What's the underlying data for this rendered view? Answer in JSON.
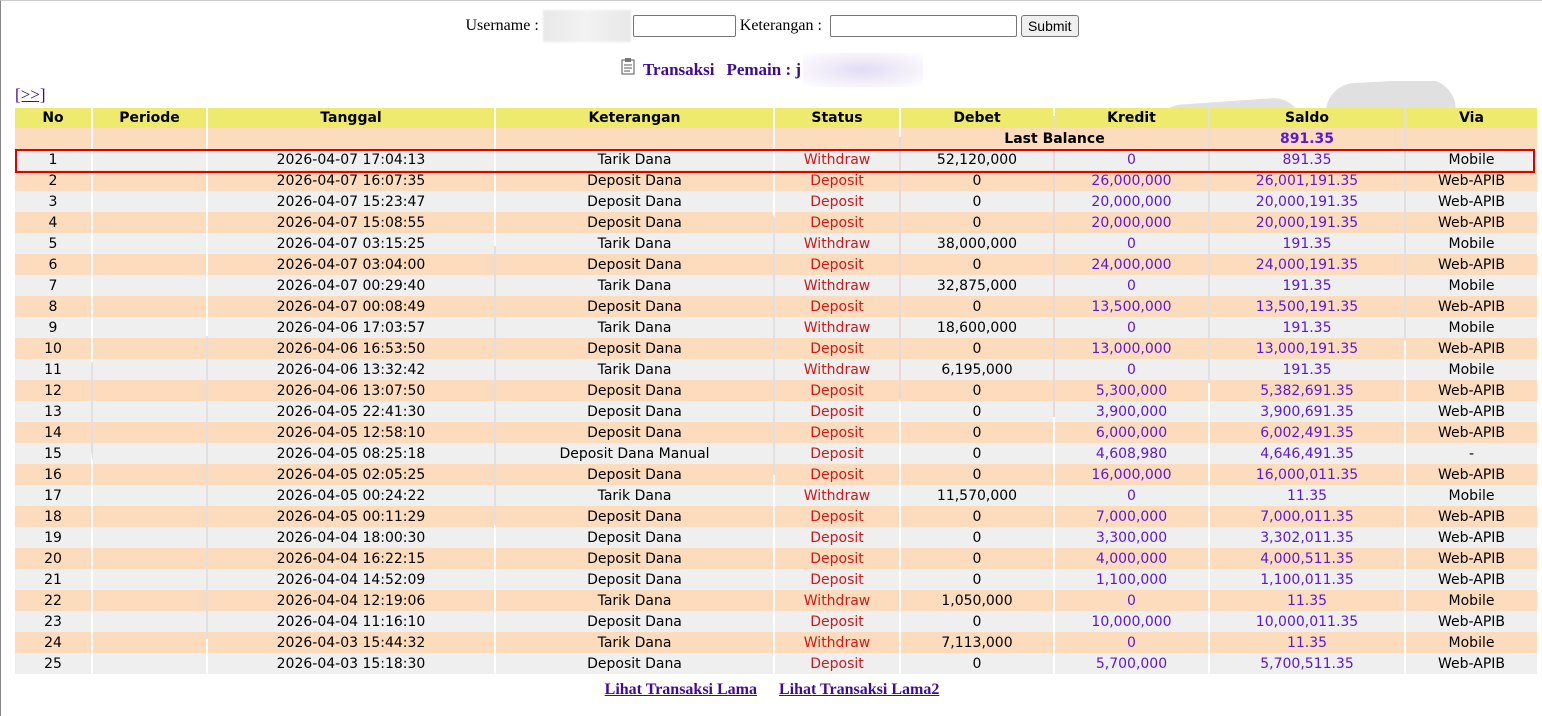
{
  "search": {
    "username_label": "Username :",
    "username_value": "",
    "keterangan_label": "Keterangan :",
    "keterangan_value": "",
    "submit_label": "Submit"
  },
  "header": {
    "title": "Transaksi",
    "player_label": "Pemain : j"
  },
  "nav_link": "[>>]",
  "columns": [
    "No",
    "Periode",
    "Tanggal",
    "Keterangan",
    "Status",
    "Debet",
    "Kredit",
    "Saldo",
    "Via"
  ],
  "last_balance": {
    "label": "Last Balance",
    "value": "891.35"
  },
  "rows": [
    {
      "no": "1",
      "periode": "",
      "tanggal": "2026-04-07 17:04:13",
      "keterangan": "Tarik Dana",
      "status": "Withdraw",
      "debet": "52,120,000",
      "kredit": "0",
      "saldo": "891.35",
      "via": "Mobile"
    },
    {
      "no": "2",
      "periode": "",
      "tanggal": "2026-04-07 16:07:35",
      "keterangan": "Deposit Dana",
      "status": "Deposit",
      "debet": "0",
      "kredit": "26,000,000",
      "saldo": "26,001,191.35",
      "via": "Web-APIB"
    },
    {
      "no": "3",
      "periode": "",
      "tanggal": "2026-04-07 15:23:47",
      "keterangan": "Deposit Dana",
      "status": "Deposit",
      "debet": "0",
      "kredit": "20,000,000",
      "saldo": "20,000,191.35",
      "via": "Web-APIB"
    },
    {
      "no": "4",
      "periode": "",
      "tanggal": "2026-04-07 15:08:55",
      "keterangan": "Deposit Dana",
      "status": "Deposit",
      "debet": "0",
      "kredit": "20,000,000",
      "saldo": "20,000,191.35",
      "via": "Web-APIB"
    },
    {
      "no": "5",
      "periode": "",
      "tanggal": "2026-04-07 03:15:25",
      "keterangan": "Tarik Dana",
      "status": "Withdraw",
      "debet": "38,000,000",
      "kredit": "0",
      "saldo": "191.35",
      "via": "Mobile"
    },
    {
      "no": "6",
      "periode": "",
      "tanggal": "2026-04-07 03:04:00",
      "keterangan": "Deposit Dana",
      "status": "Deposit",
      "debet": "0",
      "kredit": "24,000,000",
      "saldo": "24,000,191.35",
      "via": "Web-APIB"
    },
    {
      "no": "7",
      "periode": "",
      "tanggal": "2026-04-07 00:29:40",
      "keterangan": "Tarik Dana",
      "status": "Withdraw",
      "debet": "32,875,000",
      "kredit": "0",
      "saldo": "191.35",
      "via": "Mobile"
    },
    {
      "no": "8",
      "periode": "",
      "tanggal": "2026-04-07 00:08:49",
      "keterangan": "Deposit Dana",
      "status": "Deposit",
      "debet": "0",
      "kredit": "13,500,000",
      "saldo": "13,500,191.35",
      "via": "Web-APIB"
    },
    {
      "no": "9",
      "periode": "",
      "tanggal": "2026-04-06 17:03:57",
      "keterangan": "Tarik Dana",
      "status": "Withdraw",
      "debet": "18,600,000",
      "kredit": "0",
      "saldo": "191.35",
      "via": "Mobile"
    },
    {
      "no": "10",
      "periode": "",
      "tanggal": "2026-04-06 16:53:50",
      "keterangan": "Deposit Dana",
      "status": "Deposit",
      "debet": "0",
      "kredit": "13,000,000",
      "saldo": "13,000,191.35",
      "via": "Web-APIB"
    },
    {
      "no": "11",
      "periode": "",
      "tanggal": "2026-04-06 13:32:42",
      "keterangan": "Tarik Dana",
      "status": "Withdraw",
      "debet": "6,195,000",
      "kredit": "0",
      "saldo": "191.35",
      "via": "Mobile"
    },
    {
      "no": "12",
      "periode": "",
      "tanggal": "2026-04-06 13:07:50",
      "keterangan": "Deposit Dana",
      "status": "Deposit",
      "debet": "0",
      "kredit": "5,300,000",
      "saldo": "5,382,691.35",
      "via": "Web-APIB"
    },
    {
      "no": "13",
      "periode": "",
      "tanggal": "2026-04-05 22:41:30",
      "keterangan": "Deposit Dana",
      "status": "Deposit",
      "debet": "0",
      "kredit": "3,900,000",
      "saldo": "3,900,691.35",
      "via": "Web-APIB"
    },
    {
      "no": "14",
      "periode": "",
      "tanggal": "2026-04-05 12:58:10",
      "keterangan": "Deposit Dana",
      "status": "Deposit",
      "debet": "0",
      "kredit": "6,000,000",
      "saldo": "6,002,491.35",
      "via": "Web-APIB"
    },
    {
      "no": "15",
      "periode": "",
      "tanggal": "2026-04-05 08:25:18",
      "keterangan": "Deposit Dana Manual",
      "status": "Deposit",
      "debet": "0",
      "kredit": "4,608,980",
      "saldo": "4,646,491.35",
      "via": "-"
    },
    {
      "no": "16",
      "periode": "",
      "tanggal": "2026-04-05 02:05:25",
      "keterangan": "Deposit Dana",
      "status": "Deposit",
      "debet": "0",
      "kredit": "16,000,000",
      "saldo": "16,000,011.35",
      "via": "Web-APIB"
    },
    {
      "no": "17",
      "periode": "",
      "tanggal": "2026-04-05 00:24:22",
      "keterangan": "Tarik Dana",
      "status": "Withdraw",
      "debet": "11,570,000",
      "kredit": "0",
      "saldo": "11.35",
      "via": "Mobile"
    },
    {
      "no": "18",
      "periode": "",
      "tanggal": "2026-04-05 00:11:29",
      "keterangan": "Deposit Dana",
      "status": "Deposit",
      "debet": "0",
      "kredit": "7,000,000",
      "saldo": "7,000,011.35",
      "via": "Web-APIB"
    },
    {
      "no": "19",
      "periode": "",
      "tanggal": "2026-04-04 18:00:30",
      "keterangan": "Deposit Dana",
      "status": "Deposit",
      "debet": "0",
      "kredit": "3,300,000",
      "saldo": "3,302,011.35",
      "via": "Web-APIB"
    },
    {
      "no": "20",
      "periode": "",
      "tanggal": "2026-04-04 16:22:15",
      "keterangan": "Deposit Dana",
      "status": "Deposit",
      "debet": "0",
      "kredit": "4,000,000",
      "saldo": "4,000,511.35",
      "via": "Web-APIB"
    },
    {
      "no": "21",
      "periode": "",
      "tanggal": "2026-04-04 14:52:09",
      "keterangan": "Deposit Dana",
      "status": "Deposit",
      "debet": "0",
      "kredit": "1,100,000",
      "saldo": "1,100,011.35",
      "via": "Web-APIB"
    },
    {
      "no": "22",
      "periode": "",
      "tanggal": "2026-04-04 12:19:06",
      "keterangan": "Tarik Dana",
      "status": "Withdraw",
      "debet": "1,050,000",
      "kredit": "0",
      "saldo": "11.35",
      "via": "Mobile"
    },
    {
      "no": "23",
      "periode": "",
      "tanggal": "2026-04-04 11:16:10",
      "keterangan": "Deposit Dana",
      "status": "Deposit",
      "debet": "0",
      "kredit": "10,000,000",
      "saldo": "10,000,011.35",
      "via": "Web-APIB"
    },
    {
      "no": "24",
      "periode": "",
      "tanggal": "2026-04-03 15:44:32",
      "keterangan": "Tarik Dana",
      "status": "Withdraw",
      "debet": "7,113,000",
      "kredit": "0",
      "saldo": "11.35",
      "via": "Mobile"
    },
    {
      "no": "25",
      "periode": "",
      "tanggal": "2026-04-03 15:18:30",
      "keterangan": "Deposit Dana",
      "status": "Deposit",
      "debet": "0",
      "kredit": "5,700,000",
      "saldo": "5,700,511.35",
      "via": "Web-APIB"
    }
  ],
  "footer": {
    "link1": "Lihat Transaksi Lama",
    "link2": "Lihat Transaksi Lama2"
  },
  "colors": {
    "header_bg": "#eeea6e",
    "row_orange": "#fddcbe",
    "row_gray": "#efefef",
    "status_red": "#cc1a1a",
    "value_purple": "#5a18d6",
    "link_purple": "#3d0a9e",
    "highlight_red": "#e00000"
  }
}
